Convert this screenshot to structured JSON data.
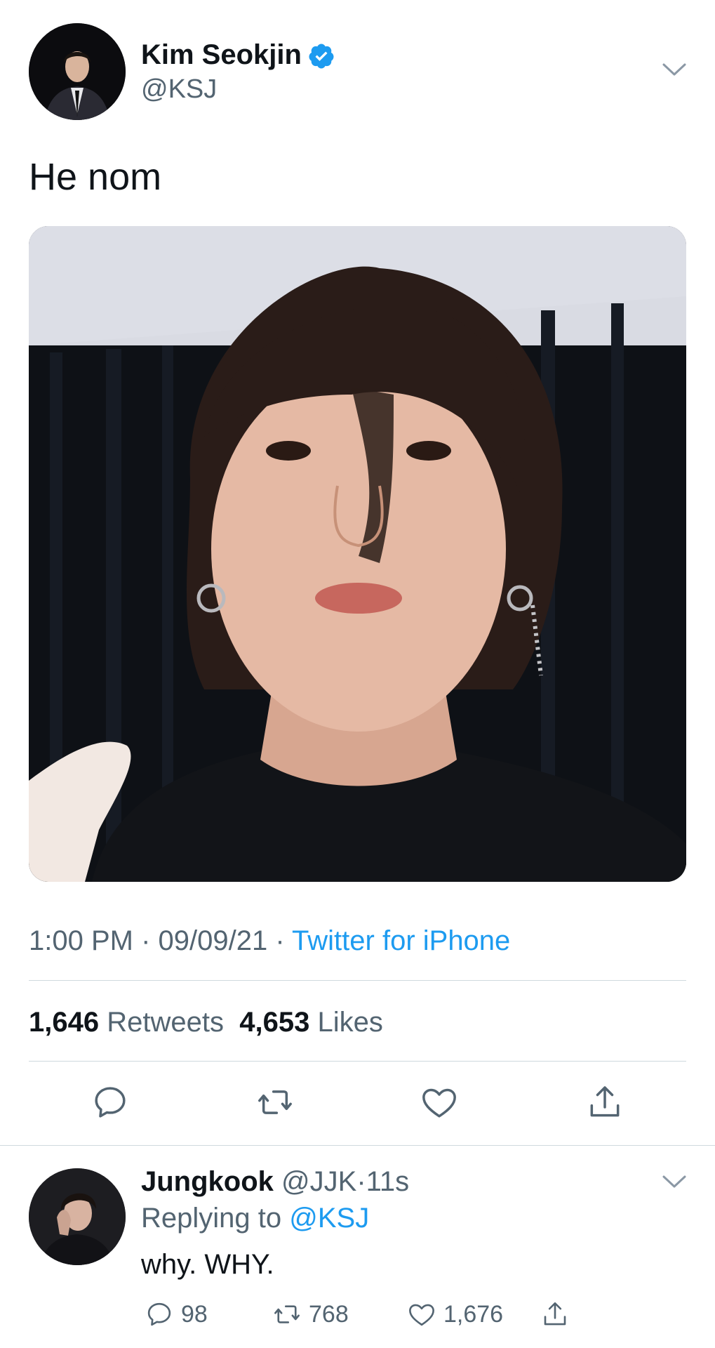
{
  "tweet": {
    "author_name": "Kim Seokjin",
    "author_handle": "@KSJ",
    "text": "He nom",
    "time": "1:00 PM",
    "separator1": " · ",
    "date": "09/09/21",
    "separator2": " · ",
    "source": "Twitter for iPhone",
    "retweet_count": "1,646",
    "retweet_label": "Retweets",
    "like_count": "4,653",
    "like_label": "Likes",
    "actions": [
      "reply-icon",
      "retweet-icon",
      "like-icon",
      "share-icon"
    ]
  },
  "reply": {
    "author_name": "Jungkook",
    "author_handle": "@JJK",
    "separator": "·",
    "age": "11s",
    "replying_label": "Replying to",
    "replying_to": "@KSJ",
    "text": "why. WHY.",
    "reply_count": "98",
    "retweet_count": "768",
    "like_count": "1,676"
  },
  "colors": {
    "accent": "#1d9bf0",
    "muted_text": "#536471",
    "divider": "#cfd9de",
    "text": "#0f1419"
  }
}
